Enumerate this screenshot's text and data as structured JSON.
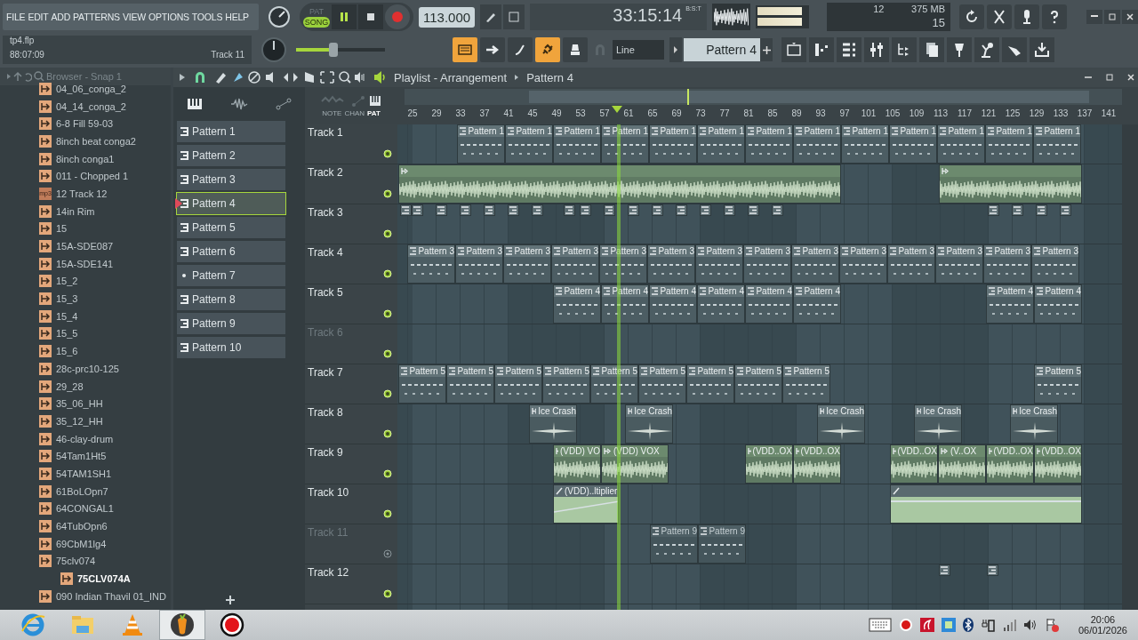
{
  "menu": [
    "FILE",
    "EDIT",
    "ADD",
    "PATTERNS",
    "VIEW",
    "OPTIONS",
    "TOOLS",
    "HELP"
  ],
  "hint_panel": {
    "file": "tp4.flp",
    "time": "88:07:09",
    "hint": "Track 11"
  },
  "transport": {
    "modes": [
      {
        "label": "PAT",
        "selected": false
      },
      {
        "label": "SONG",
        "selected": true
      }
    ],
    "playing": true,
    "tempo": "113.000",
    "time": "33:15:14",
    "time_format": "B:S:T"
  },
  "master_pitch": {
    "level": 0.42
  },
  "cpu": {
    "cpu": "12",
    "memory": "375 MB",
    "polyphony": "15"
  },
  "toolbar_buttons": [
    {
      "on": true
    },
    {
      "on": false
    },
    {
      "on": false
    },
    {
      "on": true
    },
    {
      "on": false
    }
  ],
  "snap": {
    "value": "Line"
  },
  "pattern_selector": {
    "value": "Pattern 4"
  },
  "browser": {
    "title": "Browser - Snap 1",
    "items": [
      {
        "label": "04_06_conga_2",
        "kind": "sample",
        "selected": false
      },
      {
        "label": "04_14_conga_2",
        "kind": "sample",
        "selected": false
      },
      {
        "label": "6-8 Fill 59-03",
        "kind": "sample",
        "selected": false
      },
      {
        "label": "8inch beat conga2",
        "kind": "sample",
        "selected": false
      },
      {
        "label": "8inch conga1",
        "kind": "sample",
        "selected": false
      },
      {
        "label": "011 - Chopped 1",
        "kind": "sample",
        "selected": false
      },
      {
        "label": "12 Track 12",
        "kind": "mp3",
        "badge": "mp3",
        "selected": false
      },
      {
        "label": "14in Rim",
        "kind": "sample",
        "selected": false
      },
      {
        "label": "15",
        "kind": "sample",
        "selected": false
      },
      {
        "label": "15A-SDE087",
        "kind": "sample",
        "selected": false
      },
      {
        "label": "15A-SDE141",
        "kind": "sample",
        "selected": false
      },
      {
        "label": "15_2",
        "kind": "sample",
        "selected": false
      },
      {
        "label": "15_3",
        "kind": "sample",
        "selected": false
      },
      {
        "label": "15_4",
        "kind": "sample",
        "selected": false
      },
      {
        "label": "15_5",
        "kind": "sample",
        "selected": false
      },
      {
        "label": "15_6",
        "kind": "sample",
        "selected": false
      },
      {
        "label": "28c-prc10-125",
        "kind": "sample",
        "selected": false
      },
      {
        "label": "29_28",
        "kind": "sample",
        "selected": false
      },
      {
        "label": "35_06_HH",
        "kind": "sample",
        "selected": false
      },
      {
        "label": "35_12_HH",
        "kind": "sample",
        "selected": false
      },
      {
        "label": "46-clay-drum",
        "kind": "sample",
        "selected": false
      },
      {
        "label": "54Tam1Ht5",
        "kind": "sample",
        "selected": false
      },
      {
        "label": "54TAM1SH1",
        "kind": "sample",
        "selected": false
      },
      {
        "label": "61BoLOpn7",
        "kind": "sample",
        "selected": false
      },
      {
        "label": "64CONGAL1",
        "kind": "sample",
        "selected": false
      },
      {
        "label": "64TubOpn6",
        "kind": "sample",
        "selected": false
      },
      {
        "label": "69CbM1lg4",
        "kind": "sample",
        "selected": false
      },
      {
        "label": "75clv074",
        "kind": "sample",
        "selected": false,
        "children": [
          {
            "label": "75CLV074A",
            "kind": "sample",
            "selected": true
          }
        ]
      },
      {
        "label": "090 Indian Thavil 01_IND",
        "kind": "sample",
        "selected": false
      }
    ]
  },
  "picker": {
    "patterns": [
      {
        "label": "Pattern 1",
        "kind": "notes",
        "selected": false
      },
      {
        "label": "Pattern 2",
        "kind": "notes",
        "selected": false
      },
      {
        "label": "Pattern 3",
        "kind": "notes",
        "selected": false
      },
      {
        "label": "Pattern 4",
        "kind": "notes",
        "selected": true
      },
      {
        "label": "Pattern 5",
        "kind": "notes",
        "selected": false
      },
      {
        "label": "Pattern 6",
        "kind": "notes",
        "selected": false
      },
      {
        "label": "Pattern 7",
        "kind": "dot",
        "selected": false
      },
      {
        "label": "Pattern 8",
        "kind": "notes",
        "selected": false
      },
      {
        "label": "Pattern 9",
        "kind": "notes",
        "selected": false
      },
      {
        "label": "Pattern 10",
        "kind": "notes",
        "selected": false
      }
    ]
  },
  "playlist": {
    "title": "Playlist - Arrangement",
    "pattern": "Pattern 4",
    "header_filters": [
      {
        "label": "NOTE",
        "selected": false
      },
      {
        "label": "CHAN",
        "selected": false
      },
      {
        "label": "PAT",
        "selected": true
      }
    ],
    "ruler": [
      "25",
      "29",
      "33",
      "37",
      "41",
      "45",
      "49",
      "53",
      "57",
      "61",
      "65",
      "69",
      "73",
      "77",
      "81",
      "85",
      "89",
      "93",
      "97",
      "101",
      "105",
      "109",
      "113",
      "117",
      "121",
      "125",
      "129",
      "133",
      "137",
      "141"
    ],
    "tracks": [
      {
        "name": "Track 1",
        "dimmed": false,
        "on": true,
        "clips": [
          {
            "kind": "pattern",
            "label": "Pattern 1"
          },
          {
            "kind": "pattern",
            "label": "Pattern 1"
          },
          {
            "kind": "pattern",
            "label": "Pattern 1"
          },
          {
            "kind": "pattern",
            "label": "Pattern 1"
          },
          {
            "kind": "pattern",
            "label": "Pattern 1"
          },
          {
            "kind": "pattern",
            "label": "Pattern 1"
          },
          {
            "kind": "pattern",
            "label": "Pattern 1"
          },
          {
            "kind": "pattern",
            "label": "Pattern 1"
          },
          {
            "kind": "pattern",
            "label": "Pattern 1"
          },
          {
            "kind": "pattern",
            "label": "Pattern 1"
          },
          {
            "kind": "pattern",
            "label": "Pattern 1"
          },
          {
            "kind": "pattern",
            "label": "Pattern 1"
          },
          {
            "kind": "pattern",
            "label": "Pattern 1"
          }
        ]
      },
      {
        "name": "Track 2",
        "dimmed": false,
        "on": true,
        "clips": [
          {
            "kind": "audio"
          },
          {
            "kind": "audio"
          }
        ]
      },
      {
        "name": "Track 3",
        "dimmed": false,
        "on": true,
        "clips": [
          {
            "kind": "stub"
          },
          {
            "kind": "stub"
          },
          {
            "kind": "stub"
          },
          {
            "kind": "stub"
          },
          {
            "kind": "stub"
          },
          {
            "kind": "stub"
          },
          {
            "kind": "stub"
          },
          {
            "kind": "stub"
          },
          {
            "kind": "stub"
          },
          {
            "kind": "stub"
          },
          {
            "kind": "stub"
          },
          {
            "kind": "stub"
          },
          {
            "kind": "stub"
          },
          {
            "kind": "stub"
          },
          {
            "kind": "stub"
          },
          {
            "kind": "stub"
          },
          {
            "kind": "stub"
          },
          {
            "kind": "stub"
          },
          {
            "kind": "stub"
          },
          {
            "kind": "stub"
          },
          {
            "kind": "stub"
          }
        ]
      },
      {
        "name": "Track 4",
        "dimmed": false,
        "on": true,
        "clips": [
          {
            "kind": "pattern",
            "label": "Pattern 3"
          },
          {
            "kind": "pattern",
            "label": "Pattern 3"
          },
          {
            "kind": "pattern",
            "label": "Pattern 3"
          },
          {
            "kind": "pattern",
            "label": "Pattern 3"
          },
          {
            "kind": "pattern",
            "label": "Pattern 3"
          },
          {
            "kind": "pattern",
            "label": "Pattern 3"
          },
          {
            "kind": "pattern",
            "label": "Pattern 3"
          },
          {
            "kind": "pattern",
            "label": "Pattern 3"
          },
          {
            "kind": "pattern",
            "label": "Pattern 3"
          },
          {
            "kind": "pattern",
            "label": "Pattern 3"
          },
          {
            "kind": "pattern",
            "label": "Pattern 3"
          },
          {
            "kind": "pattern",
            "label": "Pattern 3"
          },
          {
            "kind": "pattern",
            "label": "Pattern 3"
          },
          {
            "kind": "pattern",
            "label": "Pattern 3"
          }
        ]
      },
      {
        "name": "Track 5",
        "dimmed": false,
        "on": true,
        "clips": [
          {
            "kind": "pattern",
            "label": "Pattern 4"
          },
          {
            "kind": "pattern",
            "label": "Pattern 4"
          },
          {
            "kind": "pattern",
            "label": "Pattern 4"
          },
          {
            "kind": "pattern",
            "label": "Pattern 4"
          },
          {
            "kind": "pattern",
            "label": "Pattern 4"
          },
          {
            "kind": "pattern",
            "label": "Pattern 4"
          },
          {
            "kind": "pattern",
            "label": "Pattern 4"
          },
          {
            "kind": "pattern",
            "label": "Pattern 4"
          }
        ]
      },
      {
        "name": "Track 6",
        "dimmed": true,
        "on": true
      },
      {
        "name": "Track 7",
        "dimmed": false,
        "on": true,
        "clips": [
          {
            "kind": "pattern",
            "label": "Pattern 5"
          },
          {
            "kind": "pattern",
            "label": "Pattern 5"
          },
          {
            "kind": "pattern",
            "label": "Pattern 5"
          },
          {
            "kind": "pattern",
            "label": "Pattern 5"
          },
          {
            "kind": "pattern",
            "label": "Pattern 5"
          },
          {
            "kind": "pattern",
            "label": "Pattern 5"
          },
          {
            "kind": "pattern",
            "label": "Pattern 5"
          },
          {
            "kind": "pattern",
            "label": "Pattern 5"
          },
          {
            "kind": "pattern",
            "label": "Pattern 5"
          },
          {
            "kind": "pattern",
            "label": "Pattern 5"
          }
        ]
      },
      {
        "name": "Track 8",
        "dimmed": false,
        "on": true,
        "clips": [
          {
            "kind": "audio-oneshot",
            "label": "Ice Crash"
          },
          {
            "kind": "audio-oneshot",
            "label": "Ice Crash"
          },
          {
            "kind": "audio-oneshot",
            "label": "Ice Crash"
          },
          {
            "kind": "audio-oneshot",
            "label": "Ice Crash"
          },
          {
            "kind": "audio-oneshot",
            "label": "Ice Crash"
          }
        ]
      },
      {
        "name": "Track 9",
        "dimmed": false,
        "on": true,
        "clips": [
          {
            "kind": "audio",
            "label": "(VDD) VO"
          },
          {
            "kind": "audio",
            "label": "(VDD) VOX"
          },
          {
            "kind": "audio",
            "label": "(VDD..OX"
          },
          {
            "kind": "audio",
            "label": "(VDD..OX"
          },
          {
            "kind": "audio",
            "label": "(VDD..OX"
          },
          {
            "kind": "audio",
            "label": "(V..OX"
          },
          {
            "kind": "audio",
            "label": "(VDD..OX"
          },
          {
            "kind": "audio",
            "label": "(VDD..OX"
          }
        ]
      },
      {
        "name": "Track 10",
        "dimmed": false,
        "on": true,
        "clips": [
          {
            "kind": "automation",
            "label": "(VDD)..ltiplier"
          },
          {
            "kind": "automation"
          }
        ]
      },
      {
        "name": "Track 11",
        "dimmed": true,
        "on": false,
        "clips": [
          {
            "kind": "pattern",
            "label": "Pattern 9"
          },
          {
            "kind": "pattern",
            "label": "Pattern 9"
          }
        ]
      },
      {
        "name": "Track 12",
        "dimmed": false,
        "on": true,
        "clips": [
          {
            "kind": "stub"
          },
          {
            "kind": "stub"
          }
        ]
      }
    ]
  },
  "taskbar": {
    "apps": [
      {
        "active": false
      },
      {
        "active": false
      },
      {
        "active": false
      },
      {
        "active": true
      },
      {
        "active": false
      }
    ],
    "time": "20:06",
    "date": "06/01/2026"
  }
}
